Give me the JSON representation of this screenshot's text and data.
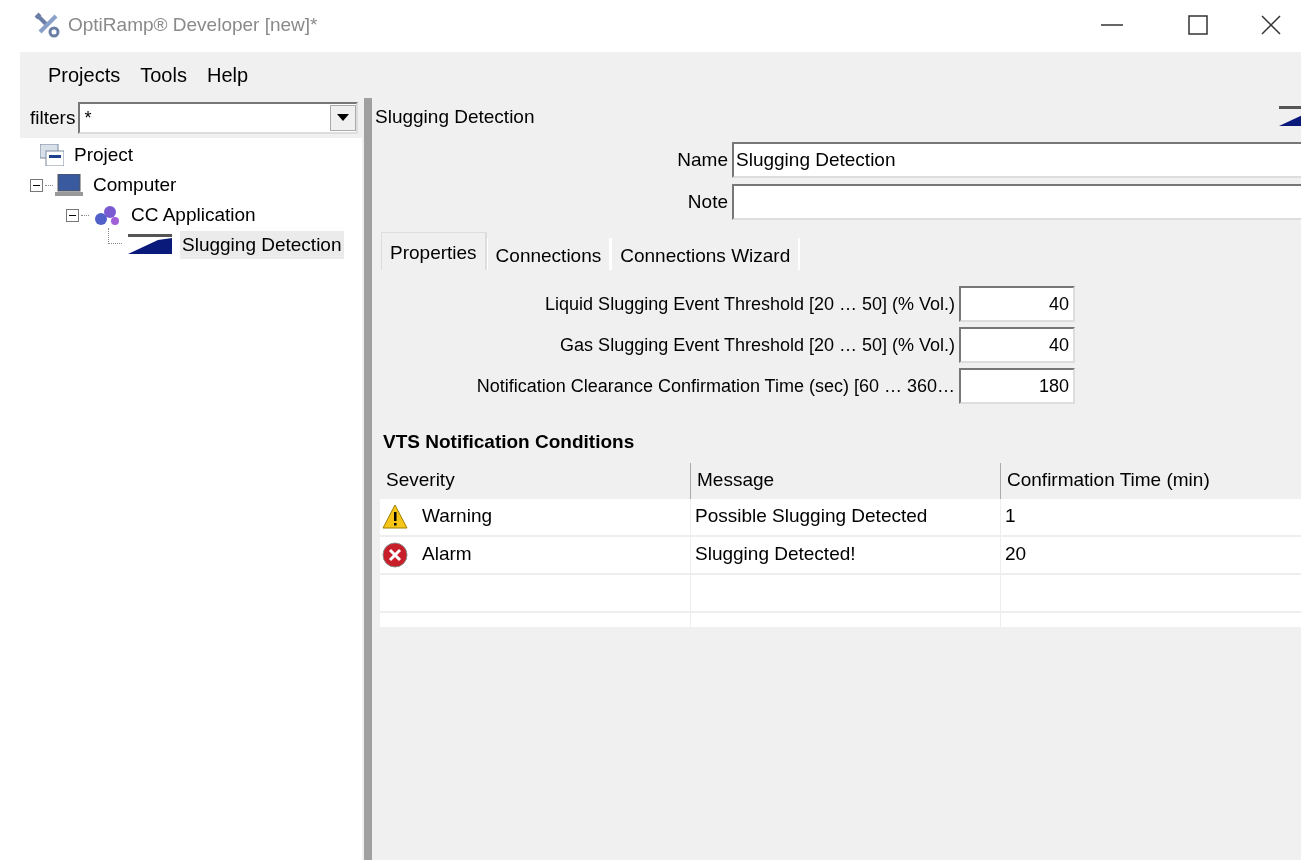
{
  "window": {
    "title": "OptiRamp® Developer [new]*"
  },
  "menu": [
    "Projects",
    "Tools",
    "Help"
  ],
  "filters": {
    "label": "filters",
    "value": "*"
  },
  "tree": [
    {
      "label": "Project",
      "kind": "project",
      "selected": false,
      "children": [
        {
          "label": "Computer",
          "kind": "computer",
          "expanded": true,
          "selected": false,
          "children": [
            {
              "label": "CC Application",
              "kind": "application",
              "expanded": true,
              "selected": false,
              "children": [
                {
                  "label": "Slugging Detection",
                  "kind": "detector",
                  "selected": true
                }
              ]
            }
          ]
        }
      ]
    }
  ],
  "panel": {
    "title": "Slugging Detection",
    "name": {
      "label": "Name",
      "value": "Slugging Detection"
    },
    "note": {
      "label": "Note"
    },
    "tabs": [
      {
        "label": "Properties",
        "selected": true
      },
      {
        "label": "Connections",
        "selected": false
      },
      {
        "label": "Connections Wizard",
        "selected": false
      }
    ],
    "properties": [
      {
        "label": "Liquid Slugging Event Threshold [20 … 50] (% Vol.)",
        "value": "40"
      },
      {
        "label": "Gas Slugging Event Threshold [20 … 50] (% Vol.)",
        "value": "40"
      },
      {
        "label": "Notification Clearance Confirmation Time (sec) [60 … 360…",
        "value": "180"
      }
    ],
    "conditions": {
      "title": "VTS Notification Conditions",
      "columns": [
        "Severity",
        "Message",
        "Confirmation Time (min)"
      ],
      "rows": [
        {
          "kind": "warning",
          "severity": "Warning",
          "message": "Possible Slugging Detected",
          "time": "1"
        },
        {
          "kind": "alarm",
          "severity": "Alarm",
          "message": "Slugging Detected!",
          "time": "20"
        }
      ]
    }
  }
}
